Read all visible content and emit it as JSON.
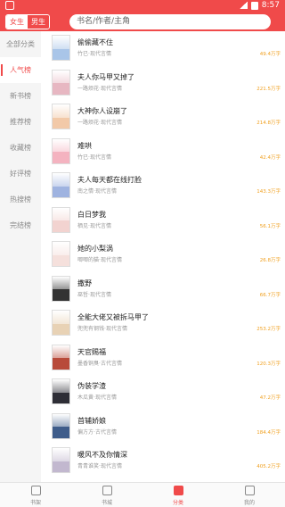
{
  "status": {
    "time": "8:57"
  },
  "header": {
    "gender_tabs": [
      "女生",
      "男生"
    ],
    "search_placeholder": "书名/作者/主角"
  },
  "sidebar": {
    "items": [
      {
        "label": "全部分类"
      },
      {
        "label": "人气榜"
      },
      {
        "label": "新书榜"
      },
      {
        "label": "推荐榜"
      },
      {
        "label": "收藏榜"
      },
      {
        "label": "好评榜"
      },
      {
        "label": "热搜榜"
      },
      {
        "label": "完结榜"
      }
    ],
    "active_index": 1
  },
  "books": [
    {
      "title": "偷偷藏不住",
      "author": "竹已",
      "genre": "现代言情",
      "count": "49.4万字",
      "color": "#a9c5e8"
    },
    {
      "title": "夫人你马甲又掉了",
      "author": "一路烦花",
      "genre": "现代言情",
      "count": "221.5万字",
      "color": "#e7b7c2"
    },
    {
      "title": "大神你人设崩了",
      "author": "一路烦花",
      "genre": "现代言情",
      "count": "214.8万字",
      "color": "#f2c9a8"
    },
    {
      "title": "难哄",
      "author": "竹已",
      "genre": "现代言情",
      "count": "42.4万字",
      "color": "#f4b3c0"
    },
    {
      "title": "夫人每天都在线打脸",
      "author": "南之情",
      "genre": "现代言情",
      "count": "143.3万字",
      "color": "#9fb3e0"
    },
    {
      "title": "白日梦我",
      "author": "栖见",
      "genre": "现代言情",
      "count": "56.1万字",
      "color": "#f2d3d0"
    },
    {
      "title": "她的小梨涡",
      "author": "唧唧的猫",
      "genre": "现代言情",
      "count": "26.8万字",
      "color": "#f5e0dc"
    },
    {
      "title": "撒野",
      "author": "巫哲",
      "genre": "现代言情",
      "count": "66.7万字",
      "color": "#333333"
    },
    {
      "title": "全能大佬又被拆马甲了",
      "author": "兜兜有钢钱",
      "genre": "现代言情",
      "count": "253.2万字",
      "color": "#e8d2b5"
    },
    {
      "title": "天官赐福",
      "author": "墨香铜臭",
      "genre": "古代言情",
      "count": "120.3万字",
      "color": "#b84a3a"
    },
    {
      "title": "伪装学渣",
      "author": "木瓜黄",
      "genre": "现代言情",
      "count": "47.2万字",
      "color": "#2e2e36"
    },
    {
      "title": "首辅娇娘",
      "author": "偏方方",
      "genre": "古代言情",
      "count": "184.4万字",
      "color": "#3e5c8a"
    },
    {
      "title": "暖风不及你情深",
      "author": "青青谁笑",
      "genre": "现代言情",
      "count": "405.2万字",
      "color": "#c2b8cf"
    }
  ],
  "tabbar": {
    "items": [
      {
        "label": "书架"
      },
      {
        "label": "书城"
      },
      {
        "label": "分类"
      },
      {
        "label": "我的"
      }
    ],
    "active_index": 2
  },
  "colors": {
    "accent": "#f04a4a",
    "count": "#f0a020"
  }
}
